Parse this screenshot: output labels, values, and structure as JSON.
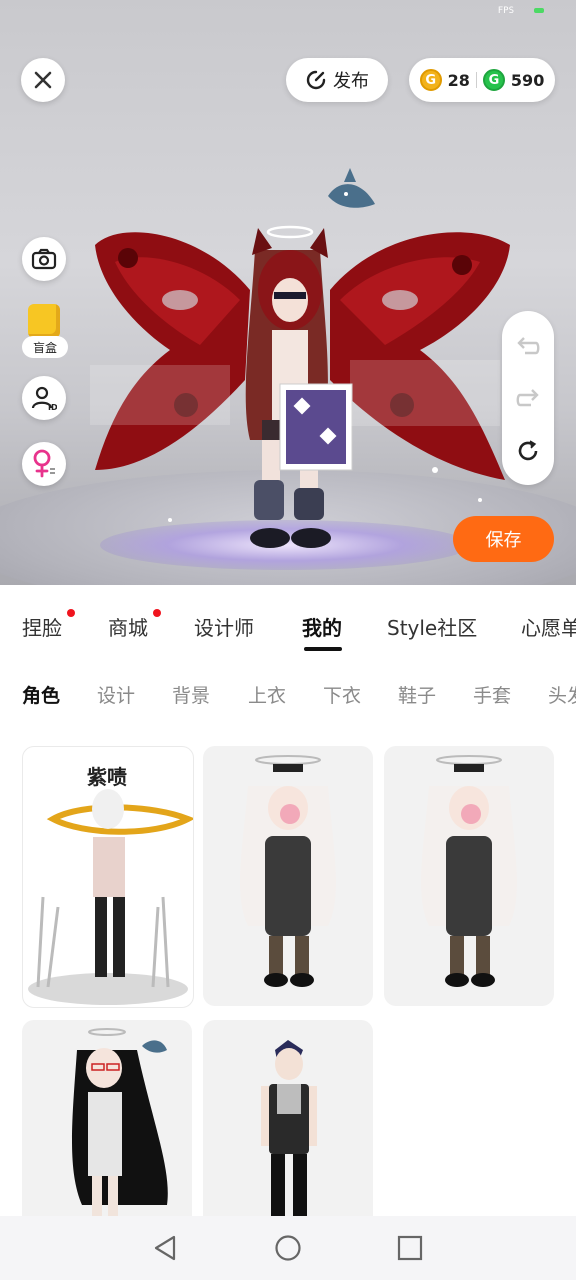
{
  "status": {
    "fps_label": "FPS"
  },
  "header": {
    "close_icon": "close-icon",
    "publish_label": "发布",
    "currency": {
      "gold": "28",
      "green": "590"
    }
  },
  "left_tools": {
    "blind_box_label": "盲盒"
  },
  "actions": {
    "save_label": "保存"
  },
  "tabs": [
    {
      "label": "捏脸",
      "dot": true
    },
    {
      "label": "商城",
      "dot": true
    },
    {
      "label": "设计师",
      "dot": false
    },
    {
      "label": "我的",
      "dot": false
    },
    {
      "label": "Style社区",
      "dot": false
    },
    {
      "label": "心愿单",
      "dot": false
    }
  ],
  "subtabs": [
    "角色",
    "设计",
    "背景",
    "上衣",
    "下衣",
    "鞋子",
    "手套",
    "头发"
  ],
  "cards": [
    {
      "caption": "紫啧"
    }
  ],
  "colors": {
    "accent": "#ff6a13",
    "gold": "#f2b21b",
    "green": "#27c24c",
    "dot": "#f0141e"
  }
}
